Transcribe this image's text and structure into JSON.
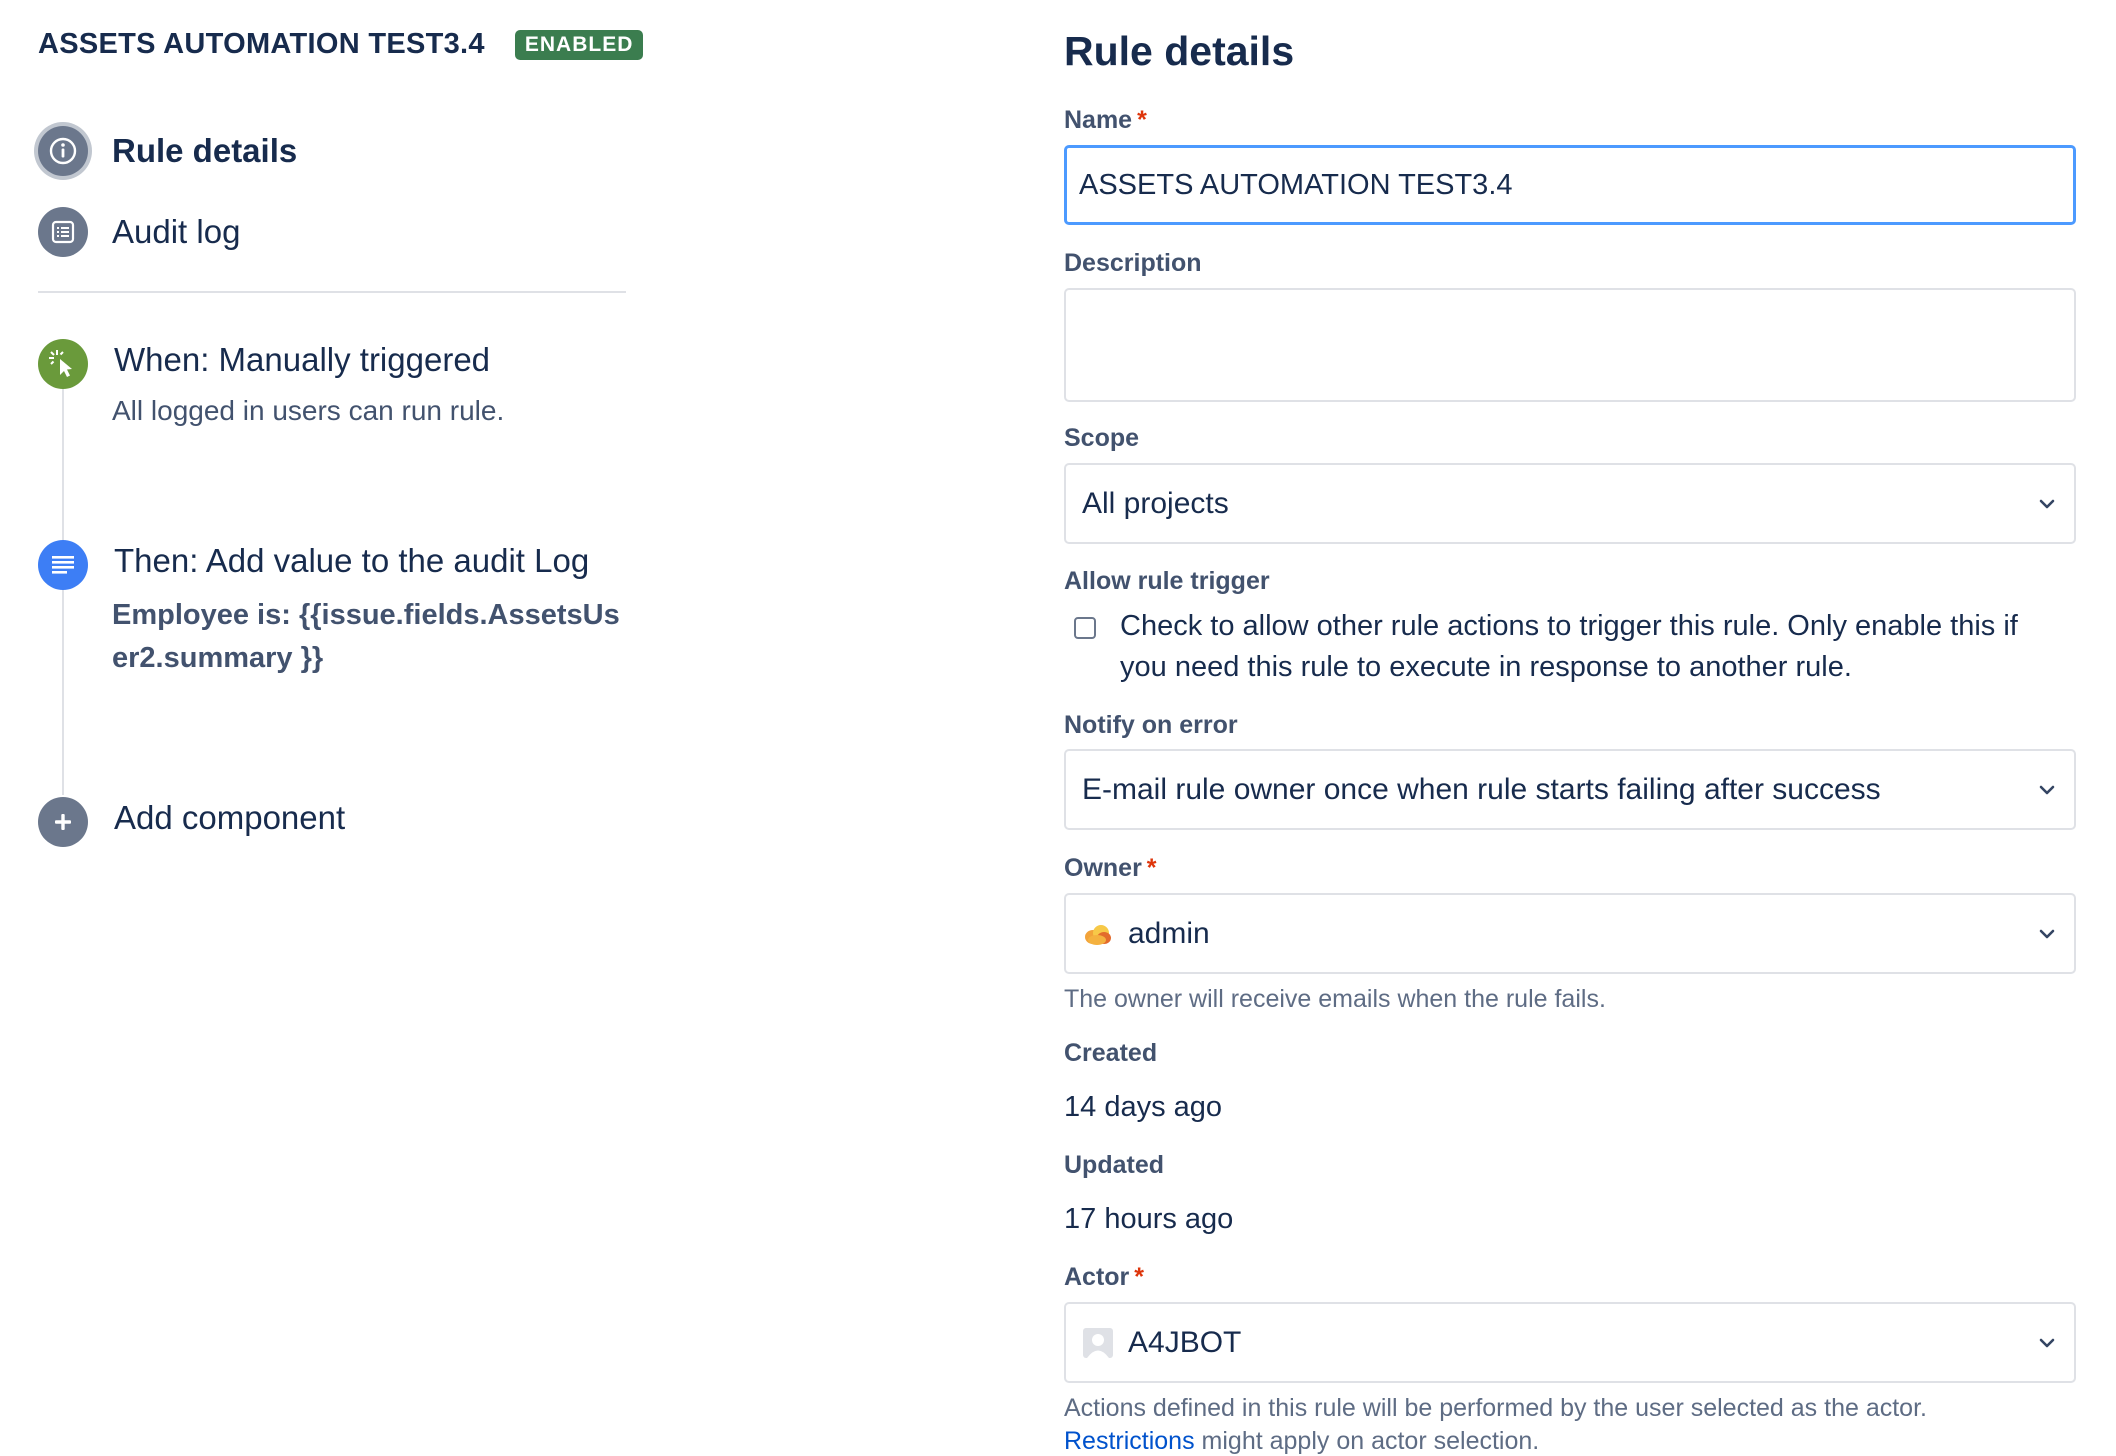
{
  "rule": {
    "name": "ASSETS AUTOMATION TEST3.4",
    "status": "ENABLED",
    "status_color": "#3b7d4f"
  },
  "nav": {
    "items": [
      {
        "label": "Rule details",
        "icon": "info-icon",
        "active": true
      },
      {
        "label": "Audit log",
        "icon": "list-icon",
        "active": false
      }
    ]
  },
  "components": {
    "trigger": {
      "title": "When: Manually triggered",
      "subtitle": "All logged in users can run rule.",
      "icon": "cursor-click-icon",
      "color": "#6a9a3b"
    },
    "action": {
      "title": "Then: Add value to the audit Log",
      "body": "Employee is: {{issue.fields.AssetsUser2.summary }}",
      "icon": "audit-log-icon",
      "color": "#3d7ef5"
    },
    "add": {
      "label": "Add component",
      "icon": "plus-icon"
    }
  },
  "form": {
    "title": "Rule details",
    "name": {
      "label": "Name",
      "required": "*",
      "value": "ASSETS AUTOMATION TEST3.4"
    },
    "description": {
      "label": "Description",
      "value": ""
    },
    "scope": {
      "label": "Scope",
      "value": "All projects"
    },
    "allow_trigger": {
      "label": "Allow rule trigger",
      "text": "Check to allow other rule actions to trigger this rule. Only enable this if you need this rule to execute in response to another rule.",
      "checked": false
    },
    "notify": {
      "label": "Notify on error",
      "value": "E-mail rule owner once when rule starts failing after success"
    },
    "owner": {
      "label": "Owner",
      "required": "*",
      "value": "admin",
      "helper": "The owner will receive emails when the rule fails."
    },
    "created": {
      "label": "Created",
      "value": "14 days ago"
    },
    "updated": {
      "label": "Updated",
      "value": "17 hours ago"
    },
    "actor": {
      "label": "Actor",
      "required": "*",
      "value": "A4JBOT",
      "helper": "Actions defined in this rule will be performed by the user selected as the actor.",
      "link": "Restrictions",
      "helper_suffix": " might apply on actor selection."
    }
  }
}
